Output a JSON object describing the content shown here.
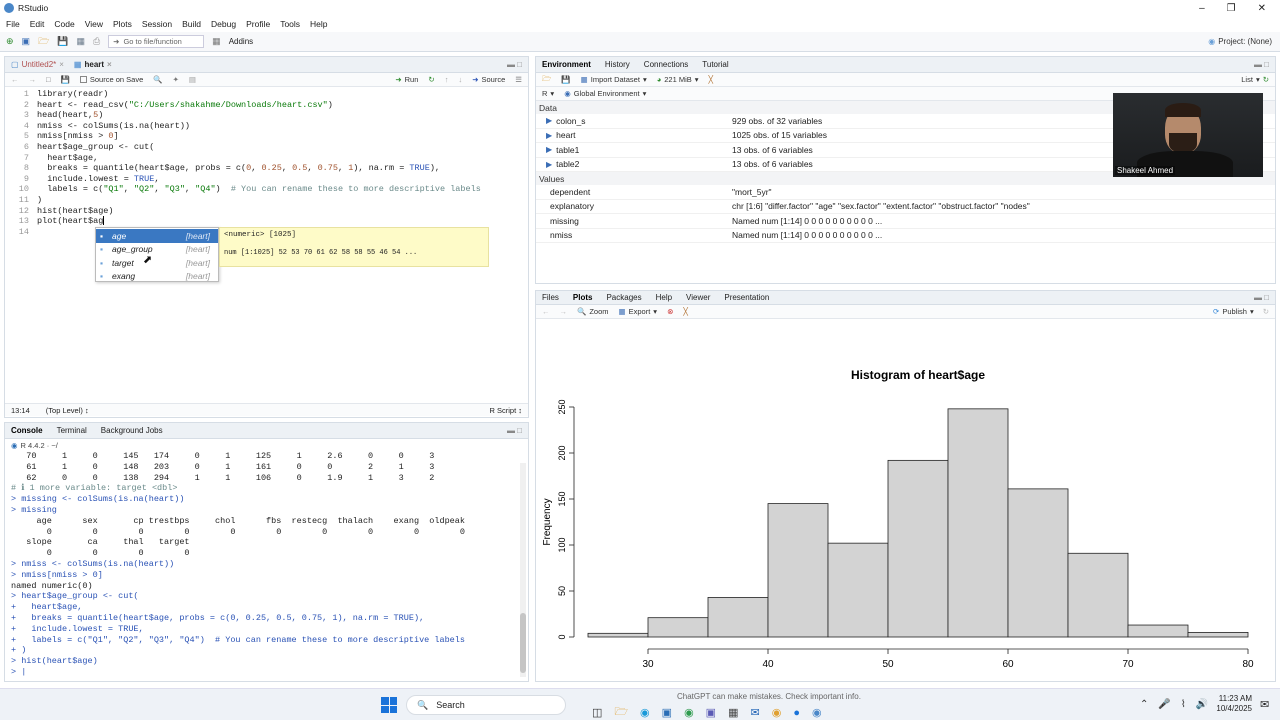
{
  "window": {
    "title": "RStudio"
  },
  "menu": [
    "File",
    "Edit",
    "Code",
    "View",
    "Plots",
    "Session",
    "Build",
    "Debug",
    "Profile",
    "Tools",
    "Help"
  ],
  "toolbar": {
    "goto_placeholder": "Go to file/function",
    "addins": "Addins",
    "project": "Project: (None)"
  },
  "editor": {
    "tabs": [
      "Untitled2*",
      "heart"
    ],
    "source_on_save": "Source on Save",
    "run": "Run",
    "source": "Source",
    "lines": [
      {
        "n": "1",
        "t": "library(readr)"
      },
      {
        "n": "2",
        "t": "heart <- read_csv(\"C:/Users/shakahme/Downloads/heart.csv\")"
      },
      {
        "n": "3",
        "t": "head(heart,5)"
      },
      {
        "n": "4",
        "t": "nmiss <- colSums(is.na(heart))"
      },
      {
        "n": "5",
        "t": "nmiss[nmiss > 0]"
      },
      {
        "n": "6",
        "t": "heart$age_group <- cut("
      },
      {
        "n": "7",
        "t": "  heart$age,"
      },
      {
        "n": "8",
        "t": "  breaks = quantile(heart$age, probs = c(0, 0.25, 0.5, 0.75, 1), na.rm = TRUE),"
      },
      {
        "n": "9",
        "t": "  include.lowest = TRUE,"
      },
      {
        "n": "10",
        "t": "  labels = c(\"Q1\", \"Q2\", \"Q3\", \"Q4\")  # You can rename these to more descriptive labels"
      },
      {
        "n": "11",
        "t": ")"
      },
      {
        "n": "12",
        "t": "hist(heart$age)"
      },
      {
        "n": "13",
        "t": "plot(heart$ag"
      },
      {
        "n": "14",
        "t": ""
      }
    ],
    "status_pos": "13:14",
    "status_level": "(Top Level) ↕",
    "status_type": "R Script ↕"
  },
  "autocomplete": {
    "items": [
      {
        "name": "age",
        "src": "[heart]"
      },
      {
        "name": "age_group",
        "src": "[heart]"
      },
      {
        "name": "target",
        "src": "[heart]"
      },
      {
        "name": "exang",
        "src": "[heart]"
      }
    ],
    "info_type": "<numeric> [1025]",
    "info_values": "num [1:1025] 52 53 70 61 62 58 58 55 46 54 ..."
  },
  "console": {
    "tabs": [
      "Console",
      "Terminal",
      "Background Jobs"
    ],
    "rversion": "R 4.4.2 · ~/",
    "lines": [
      {
        "t": "   70     1     0     145   174     0     1     125     1     2.6     0     0     3",
        "c": ""
      },
      {
        "t": "   61     1     0     148   203     0     1     161     0     0       2     1     3",
        "c": ""
      },
      {
        "t": "   62     0     0     138   294     1     1     106     0     1.9     1     3     2",
        "c": ""
      },
      {
        "t": "# ℹ 1 more variable: target <dbl>",
        "c": "cmt"
      },
      {
        "t": "> missing <- colSums(is.na(heart))",
        "c": "blue"
      },
      {
        "t": "> missing",
        "c": "blue"
      },
      {
        "t": "     age      sex       cp trestbps     chol      fbs  restecg  thalach    exang  oldpeak",
        "c": ""
      },
      {
        "t": "       0        0        0        0        0        0        0        0        0        0",
        "c": ""
      },
      {
        "t": "   slope       ca     thal   target",
        "c": ""
      },
      {
        "t": "       0        0        0        0",
        "c": ""
      },
      {
        "t": "> nmiss <- colSums(is.na(heart))",
        "c": "blue"
      },
      {
        "t": "> nmiss[nmiss > 0]",
        "c": "blue"
      },
      {
        "t": "named numeric(0)",
        "c": ""
      },
      {
        "t": "> heart$age_group <- cut(",
        "c": "blue"
      },
      {
        "t": "+   heart$age,",
        "c": "blue"
      },
      {
        "t": "+   breaks = quantile(heart$age, probs = c(0, 0.25, 0.5, 0.75, 1), na.rm = TRUE),",
        "c": "blue"
      },
      {
        "t": "+   include.lowest = TRUE,",
        "c": "blue"
      },
      {
        "t": "+   labels = c(\"Q1\", \"Q2\", \"Q3\", \"Q4\")  # You can rename these to more descriptive labels",
        "c": "blue"
      },
      {
        "t": "+ )",
        "c": "blue"
      },
      {
        "t": "> hist(heart$age)",
        "c": "blue"
      },
      {
        "t": "> |",
        "c": "blue"
      }
    ]
  },
  "environment": {
    "tabs": [
      "Environment",
      "History",
      "Connections",
      "Tutorial"
    ],
    "import_dataset": "Import Dataset",
    "memory": "221 MiB",
    "list_view": "List",
    "lang": "R",
    "scope": "Global Environment",
    "data_header": "Data",
    "data": [
      {
        "name": "colon_s",
        "value": "929 obs. of 32 variables"
      },
      {
        "name": "heart",
        "value": "1025 obs. of 15 variables"
      },
      {
        "name": "table1",
        "value": "13 obs. of 6 variables"
      },
      {
        "name": "table2",
        "value": "13 obs. of 6 variables"
      }
    ],
    "values_header": "Values",
    "values": [
      {
        "name": "dependent",
        "value": "\"mort_5yr\""
      },
      {
        "name": "explanatory",
        "value": "chr [1:6] \"differ.factor\" \"age\" \"sex.factor\" \"extent.factor\" \"obstruct.factor\" \"nodes\""
      },
      {
        "name": "missing",
        "value": "Named num [1:14] 0 0 0 0 0 0 0 0 0 0 ..."
      },
      {
        "name": "nmiss",
        "value": "Named num [1:14] 0 0 0 0 0 0 0 0 0 0 ..."
      }
    ]
  },
  "webcam": {
    "name": "Shakeel Ahmed"
  },
  "plots": {
    "tabs": [
      "Files",
      "Plots",
      "Packages",
      "Help",
      "Viewer",
      "Presentation"
    ],
    "zoom": "Zoom",
    "export": "Export",
    "publish": "Publish"
  },
  "chart_data": {
    "type": "bar",
    "title": "Histogram of heart$age",
    "xlabel": "heart$age",
    "ylabel": "Frequency",
    "bins": [
      [
        25,
        30
      ],
      [
        30,
        35
      ],
      [
        35,
        40
      ],
      [
        40,
        45
      ],
      [
        45,
        50
      ],
      [
        50,
        55
      ],
      [
        55,
        60
      ],
      [
        60,
        65
      ],
      [
        65,
        70
      ],
      [
        70,
        75
      ],
      [
        75,
        80
      ]
    ],
    "values": [
      4,
      21,
      43,
      145,
      102,
      192,
      248,
      161,
      91,
      13,
      5
    ],
    "xticks": [
      30,
      40,
      50,
      60,
      70,
      80
    ],
    "yticks": [
      0,
      50,
      100,
      150,
      200,
      250
    ],
    "xlim": [
      25,
      80
    ],
    "ylim": [
      0,
      250
    ],
    "bar_color": "#d3d3d3"
  },
  "taskbar": {
    "search": "Search",
    "notice": "ChatGPT can make mistakes. Check important info.",
    "time": "11:23 AM",
    "date": "10/4/2025"
  }
}
